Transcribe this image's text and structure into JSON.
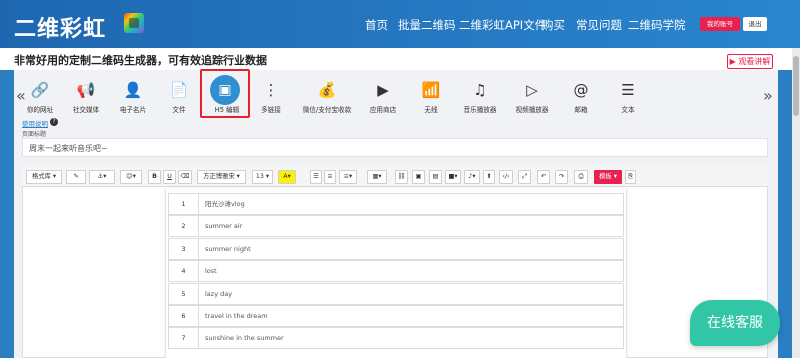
{
  "header": {
    "logo_text": "二维彩虹",
    "nav": [
      "首页",
      "批量二维码",
      "二维彩虹API文件",
      "购买",
      "常见问题",
      "二维码学院"
    ],
    "account_label": "我的账号",
    "logout_label": "退出"
  },
  "subheader": {
    "slogan": "非常好用的定制二维码生成器，可有效追踪行业数据",
    "watch_label": "▶ 观看讲解"
  },
  "tools": {
    "prev_arrow": "«",
    "next_arrow": "»",
    "items": [
      {
        "label": "你的网址",
        "icon": "🔗"
      },
      {
        "label": "社交媒体",
        "icon": "📢"
      },
      {
        "label": "电子名片",
        "icon": "👤"
      },
      {
        "label": "文件",
        "icon": "📄"
      },
      {
        "label": "H5 编辑",
        "icon": "▣"
      },
      {
        "label": "多链接",
        "icon": "⋮"
      },
      {
        "label": "微信/支付宝收款",
        "icon": "💰"
      },
      {
        "label": "应用商店",
        "icon": "▶"
      },
      {
        "label": "无线",
        "icon": "📶"
      },
      {
        "label": "音乐播放器",
        "icon": "♫"
      },
      {
        "label": "视频播放器",
        "icon": "▷"
      },
      {
        "label": "邮箱",
        "icon": "@"
      },
      {
        "label": "文本",
        "icon": "☰"
      }
    ]
  },
  "form": {
    "help_link": "使用说明",
    "help_icon": "?",
    "page_title_label": "页面标题",
    "page_title_value": "周末一起来听音乐吧~"
  },
  "editor_toolbar": {
    "format_lib": "格式库",
    "font_family": "方正博雅宋",
    "font_size": "13",
    "template": "模板"
  },
  "playlist": [
    {
      "num": "1",
      "title": "阳光沙滩vlog"
    },
    {
      "num": "2",
      "title": "summer air"
    },
    {
      "num": "3",
      "title": "summer night"
    },
    {
      "num": "4",
      "title": "lost"
    },
    {
      "num": "5",
      "title": "lazy day"
    },
    {
      "num": "6",
      "title": "travel in the dream"
    },
    {
      "num": "7",
      "title": "sunshine in the summer"
    }
  ],
  "chat": {
    "label": "在线客服"
  },
  "colors": {
    "brand": "#2a7fc3",
    "accent": "#e8214e",
    "chat": "#31c7a6"
  }
}
